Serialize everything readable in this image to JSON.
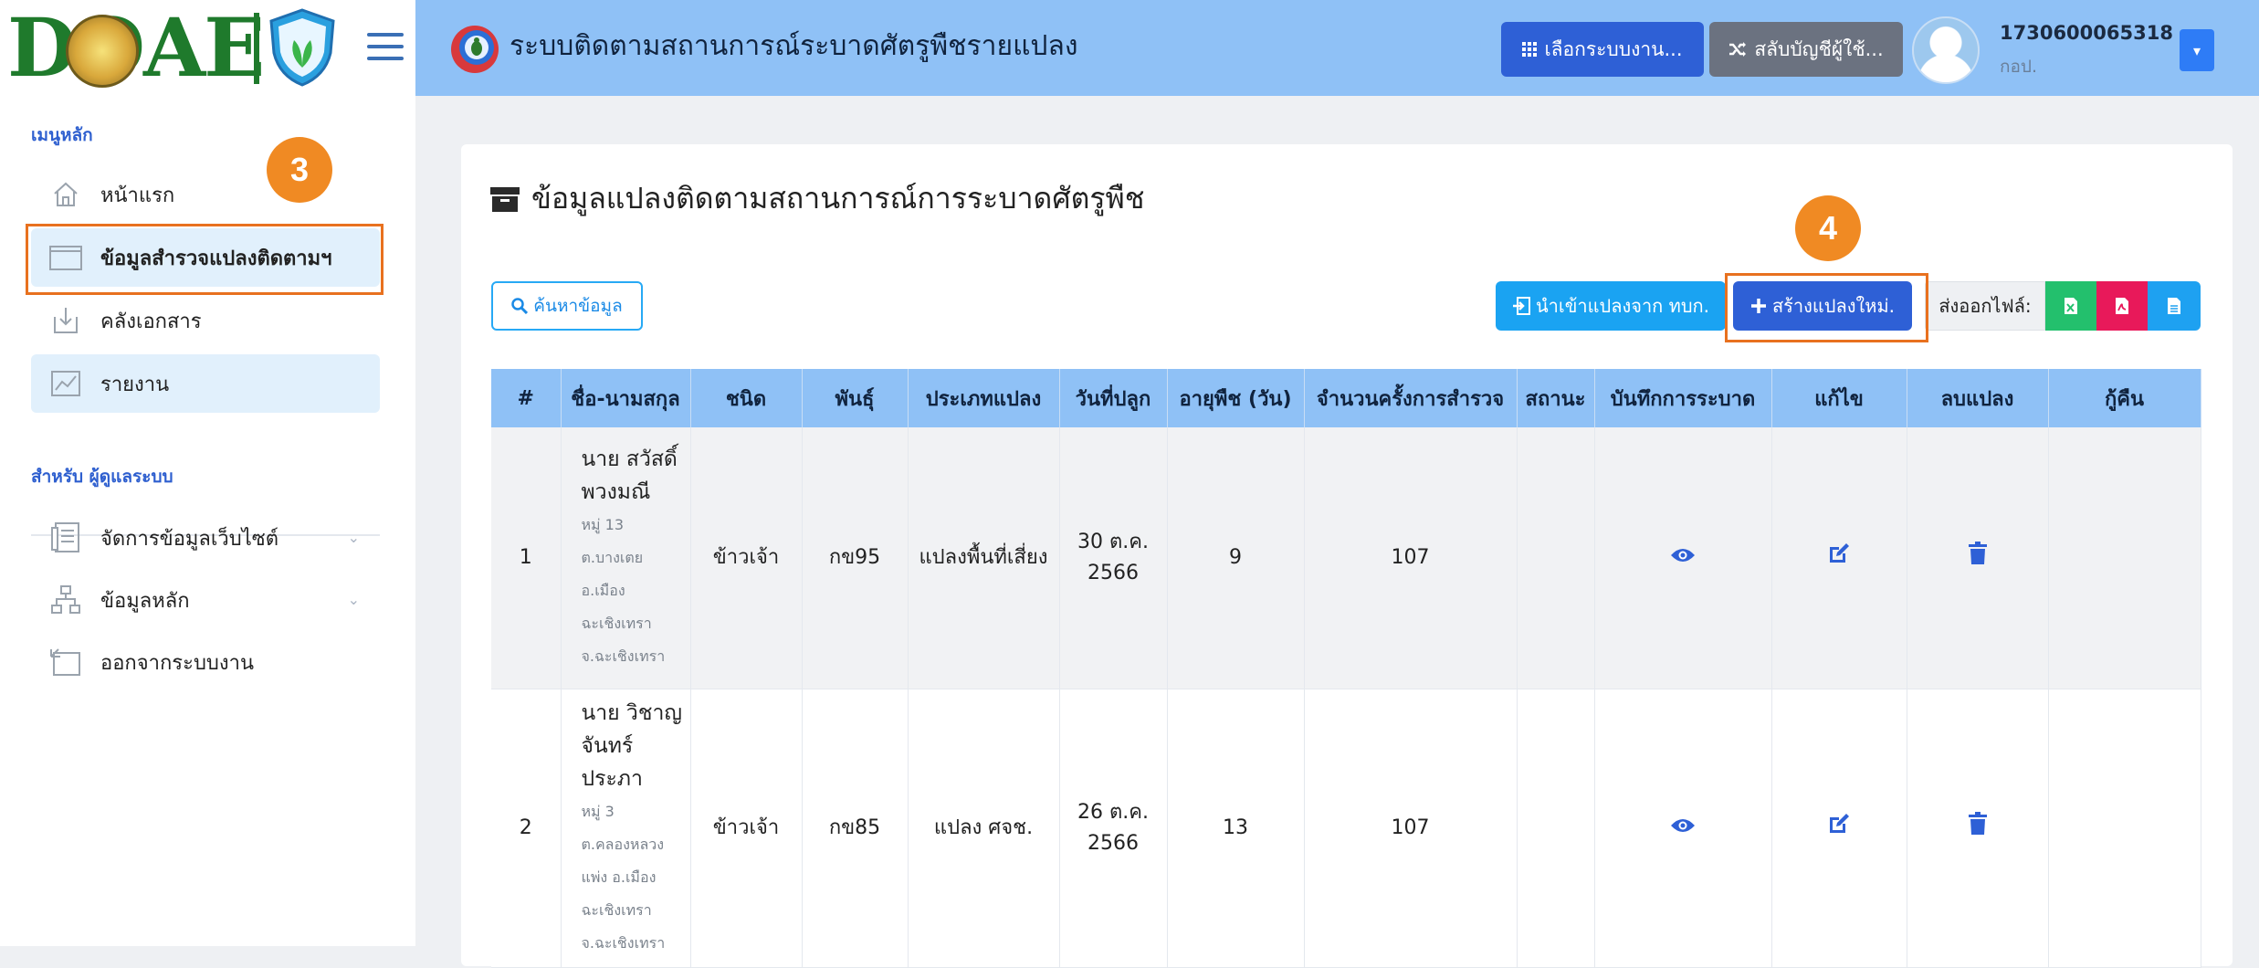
{
  "header": {
    "logo_text": "DOAE",
    "app_title": "ระบบติดตามสถานการณ์ระบาดศัตรูพืชรายแปลง",
    "select_system_label": "เลือกระบบงาน...",
    "switch_account_label": "สลับบัญชีผู้ใช้...",
    "user_id": "1730600065318",
    "user_org": "กอป."
  },
  "sidebar": {
    "main_heading": "เมนูหลัก",
    "items": [
      {
        "label": "หน้าแรก",
        "icon": "home-icon"
      },
      {
        "label": "ข้อมูลสำรวจแปลงติดตามฯ",
        "icon": "window-icon"
      },
      {
        "label": "คลังเอกสาร",
        "icon": "download-icon"
      },
      {
        "label": "รายงาน",
        "icon": "chart-icon"
      }
    ],
    "admin_heading": "สำหรับ ผู้ดูแลระบบ",
    "admin_items": [
      {
        "label": "จัดการข้อมูลเว็บไซต์",
        "icon": "layout-icon"
      },
      {
        "label": "ข้อมูลหลัก",
        "icon": "sitemap-icon"
      },
      {
        "label": "ออกจากระบบงาน",
        "icon": "logout-icon"
      }
    ]
  },
  "steps": {
    "step3": "3",
    "step4": "4"
  },
  "page": {
    "title": "ข้อมูลแปลงติดตามสถานการณ์การระบาดศัตรูพืช",
    "search_button": "ค้นหาข้อมูล",
    "import_button": "นำเข้าแปลงจาก ทบก.",
    "create_button": "สร้างแปลงใหม่.",
    "export_label": "ส่งออกไฟล์:"
  },
  "table": {
    "headers": [
      "#",
      "ชื่อ-นามสกุล",
      "ชนิด",
      "พันธุ์",
      "ประเภทแปลง",
      "วันที่ปลูก",
      "อายุพืช (วัน)",
      "จำนวนครั้งการสำรวจ",
      "สถานะ",
      "บันทึกการระบาด",
      "แก้ไข",
      "ลบแปลง",
      "กู้คืน"
    ],
    "rows": [
      {
        "no": "1",
        "name": "นาย สวัสดิ์ พวงมณี",
        "address": "หมู่ 13\nต.บางเตย\nอ.เมือง\nฉะเชิงเทรา\nจ.ฉะเชิงเทรา",
        "crop": "ข้าวเจ้า",
        "variety": "กข95",
        "plot_type": "แปลงพื้นที่เสี่ยง",
        "plant_date": "30 ต.ค. 2566",
        "age": "9",
        "survey_count": "107",
        "status": ""
      },
      {
        "no": "2",
        "name": "นาย วิชาญ จันทร์ประภา",
        "address": "หมู่ 3\nต.คลองหลวง\nแพ่ง อ.เมือง\nฉะเชิงเทรา\nจ.ฉะเชิงเทรา",
        "crop": "ข้าวเจ้า",
        "variety": "กข85",
        "plot_type": "แปลง ศจช.",
        "plant_date": "26 ต.ค. 2566",
        "age": "13",
        "survey_count": "107",
        "status": ""
      }
    ]
  },
  "colors": {
    "accent": "#2e60d6",
    "topbar": "#8fc1f6",
    "highlight": "#e8711f"
  }
}
